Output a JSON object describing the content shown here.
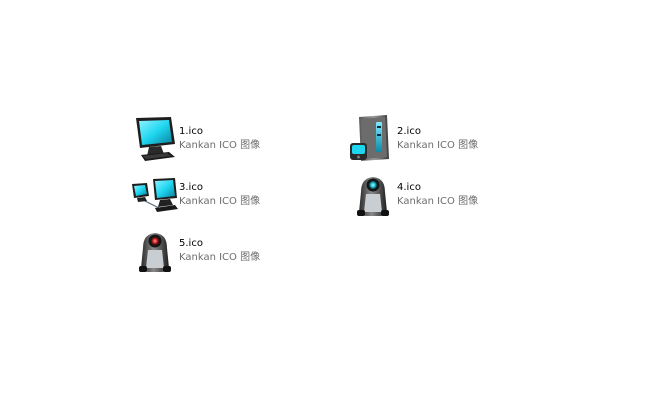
{
  "files": [
    {
      "name": "1.ico",
      "type": "Kankan ICO 图像",
      "icon": "monitor-icon"
    },
    {
      "name": "2.ico",
      "type": "Kankan ICO 图像",
      "icon": "pc-tower-icon"
    },
    {
      "name": "3.ico",
      "type": "Kankan ICO 图像",
      "icon": "network-computers-icon"
    },
    {
      "name": "4.ico",
      "type": "Kankan ICO 图像",
      "icon": "robot-webcam-icon"
    },
    {
      "name": "5.ico",
      "type": "Kankan ICO 图像",
      "icon": "robot-webcam-red-icon"
    }
  ],
  "colors": {
    "screen_cyan": "#1fd6f0",
    "bezel_dark": "#1e1e1e",
    "name_text": "#000000",
    "type_text": "#6d6d6d",
    "lens_teal": "#28c8d8",
    "lens_red": "#d22a2a"
  }
}
